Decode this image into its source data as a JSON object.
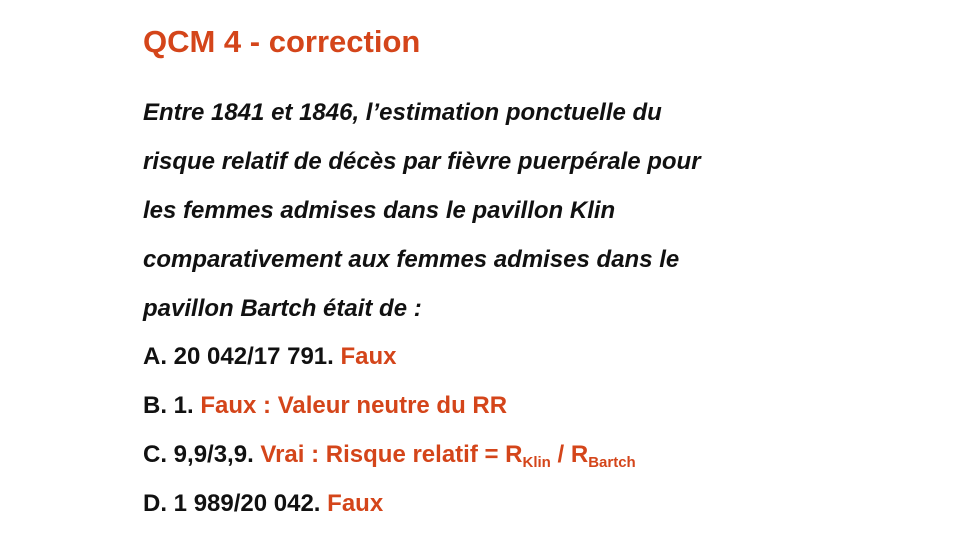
{
  "slide": {
    "title": "QCM 4 - correction",
    "question_lines": [
      "Entre 1841 et 1846, l’estimation ponctuelle du",
      "risque relatif de décès par fièvre puerpérale pour",
      "les femmes admises dans le pavillon Klin",
      "comparativement aux femmes admises dans le",
      "pavillon Bartch était de :"
    ],
    "answers": [
      {
        "label": "A.",
        "value": "20 042/17 791.",
        "verdict": "Faux"
      },
      {
        "label": "B.",
        "value": "1.",
        "verdict": "Faux : Valeur neutre du RR"
      },
      {
        "label": "C.",
        "value": "9,9/3,9.",
        "verdict": "Vrai : Risque relatif = R",
        "sub1": "Klin",
        "mid": " / R",
        "sub2": "Bartch"
      },
      {
        "label": "D.",
        "value": "1 989/20 042.",
        "verdict": "Faux"
      }
    ],
    "colors": {
      "accent": "#d4451a",
      "text": "#111111",
      "background": "#ffffff"
    }
  }
}
